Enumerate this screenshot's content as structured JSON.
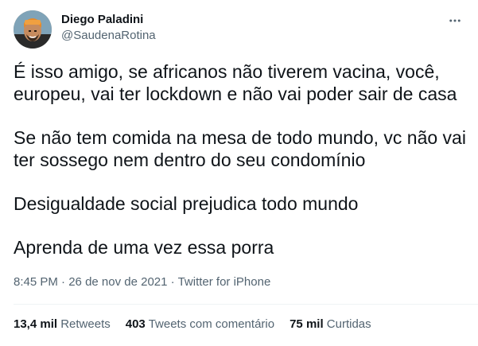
{
  "author": {
    "name": "Diego Paladini",
    "handle": "@SaudenaRotina"
  },
  "tweet": {
    "paragraphs": [
      "É isso amigo, se africanos não tiverem vacina, você, europeu, vai ter lockdown e não vai poder sair de casa",
      "Se não tem comida na mesa de todo mundo, vc não vai ter sossego nem dentro do seu condomínio",
      "Desigualdade social prejudica todo mundo",
      "Aprenda de uma vez essa porra"
    ]
  },
  "meta": {
    "time": "8:45 PM",
    "separator": "·",
    "date": "26 de nov de 2021",
    "source": "Twitter for iPhone"
  },
  "stats": {
    "retweets_count": "13,4 mil",
    "retweets_label": "Retweets",
    "quotes_count": "403",
    "quotes_label": "Tweets com comentário",
    "likes_count": "75 mil",
    "likes_label": "Curtidas"
  },
  "icons": {
    "more": "more-horizontal-icon",
    "avatar": "profile-photo"
  },
  "colors": {
    "text_primary": "#0f1419",
    "text_secondary": "#536471",
    "divider": "#eff3f4"
  }
}
